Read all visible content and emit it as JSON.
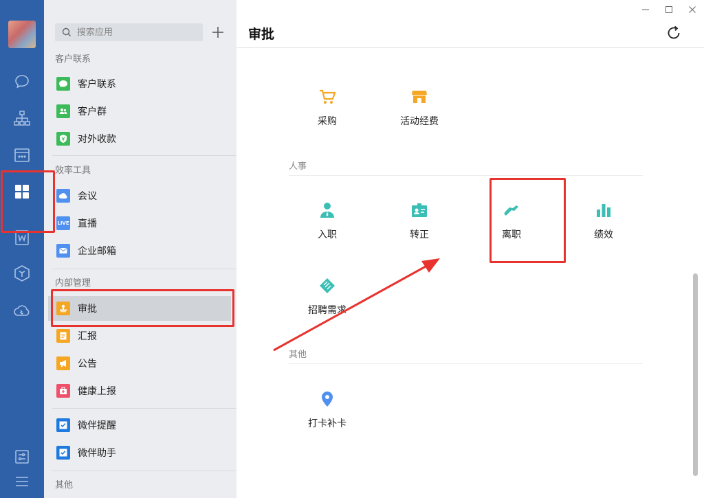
{
  "search": {
    "placeholder": "搜索应用"
  },
  "sidebar": {
    "sections": [
      {
        "title": "客户联系",
        "items": [
          "客户联系",
          "客户群",
          "对外收款"
        ]
      },
      {
        "title": "效率工具",
        "items": [
          "会议",
          "直播",
          "企业邮箱"
        ]
      },
      {
        "title": "内部管理",
        "items": [
          "审批",
          "汇报",
          "公告",
          "健康上报"
        ]
      },
      {
        "title": "",
        "items": [
          "微伴提醒",
          "微伴助手"
        ]
      },
      {
        "title": "其他",
        "items": []
      }
    ],
    "live_badge": "LIVE"
  },
  "main": {
    "title": "审批",
    "top_apps": [
      "采购",
      "活动经费"
    ],
    "categories": [
      {
        "name": "人事",
        "apps": [
          "入职",
          "转正",
          "离职",
          "绩效",
          "招聘需求"
        ]
      },
      {
        "name": "其他",
        "apps": [
          "打卡补卡"
        ]
      }
    ]
  },
  "colors": {
    "rail": "#2f61a8",
    "sidebar": "#ebedf0",
    "annotation": "#e8322e",
    "orange": "#f5a623",
    "teal": "#3bbfb5",
    "green": "#3dbb5b",
    "blue": "#4f90f0"
  },
  "icons": {
    "rail": [
      "chat-icon",
      "org-chart-icon",
      "calendar-icon",
      "apps-grid-icon",
      "doc-icon",
      "cube-icon",
      "cloud-phone-icon",
      "settings-sliders-icon",
      "menu-icon"
    ],
    "apps": [
      "cart-icon",
      "shop-icon",
      "person-icon",
      "badge-icon",
      "handshake-icon",
      "bar-chart-icon",
      "diamond-icon",
      "location-pin-icon"
    ]
  }
}
